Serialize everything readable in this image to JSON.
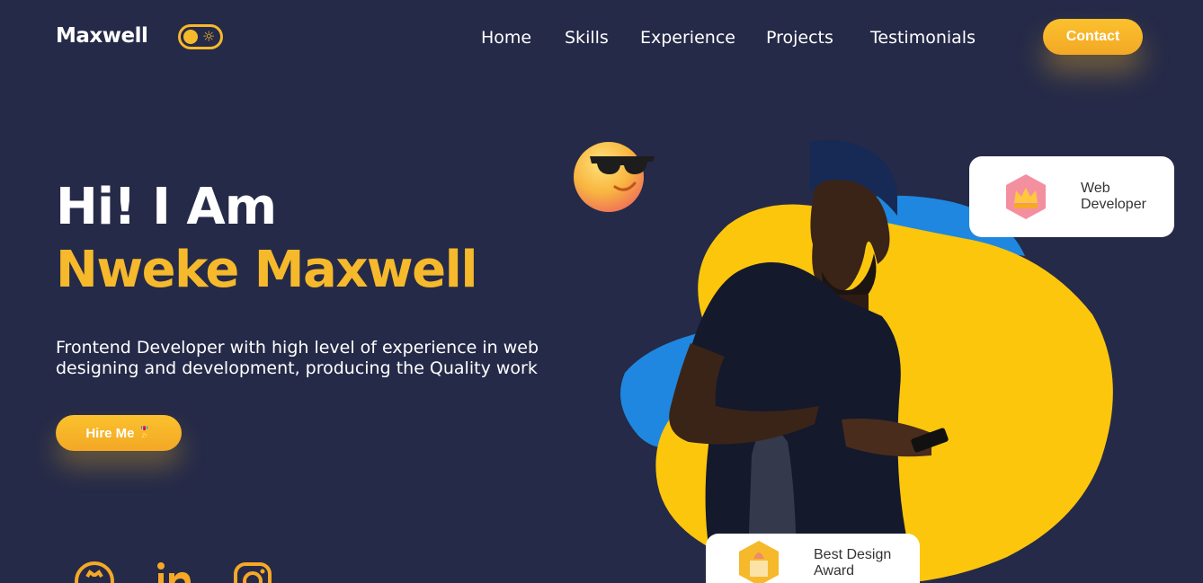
{
  "header": {
    "logo": "Maxwell",
    "theme_toggle_icon": "sun-icon",
    "nav": [
      {
        "label": "Home"
      },
      {
        "label": "Skills"
      },
      {
        "label": "Experience"
      },
      {
        "label": "Projects"
      },
      {
        "label": "Testimonials"
      }
    ],
    "contact_label": "Contact"
  },
  "hero": {
    "greeting": "Hi! I Am",
    "name": "Nweke Maxwell",
    "description": "Frontend Developer with high level of experience in web designing and development, producing the Quality work",
    "hire_label": "Hire Me",
    "hire_icon": "🎖️",
    "socials": [
      {
        "icon": "github-icon"
      },
      {
        "icon": "linkedin-icon"
      },
      {
        "icon": "instagram-icon"
      }
    ]
  },
  "cards": {
    "web_developer": "Web\nDeveloper",
    "best_design_award": "Best Design\nAward"
  },
  "colors": {
    "background": "#252a48",
    "accent": "#f6b92b",
    "blob_yellow": "#fcc60d",
    "blob_blue": "#1e87e0",
    "text": "#ffffff"
  }
}
